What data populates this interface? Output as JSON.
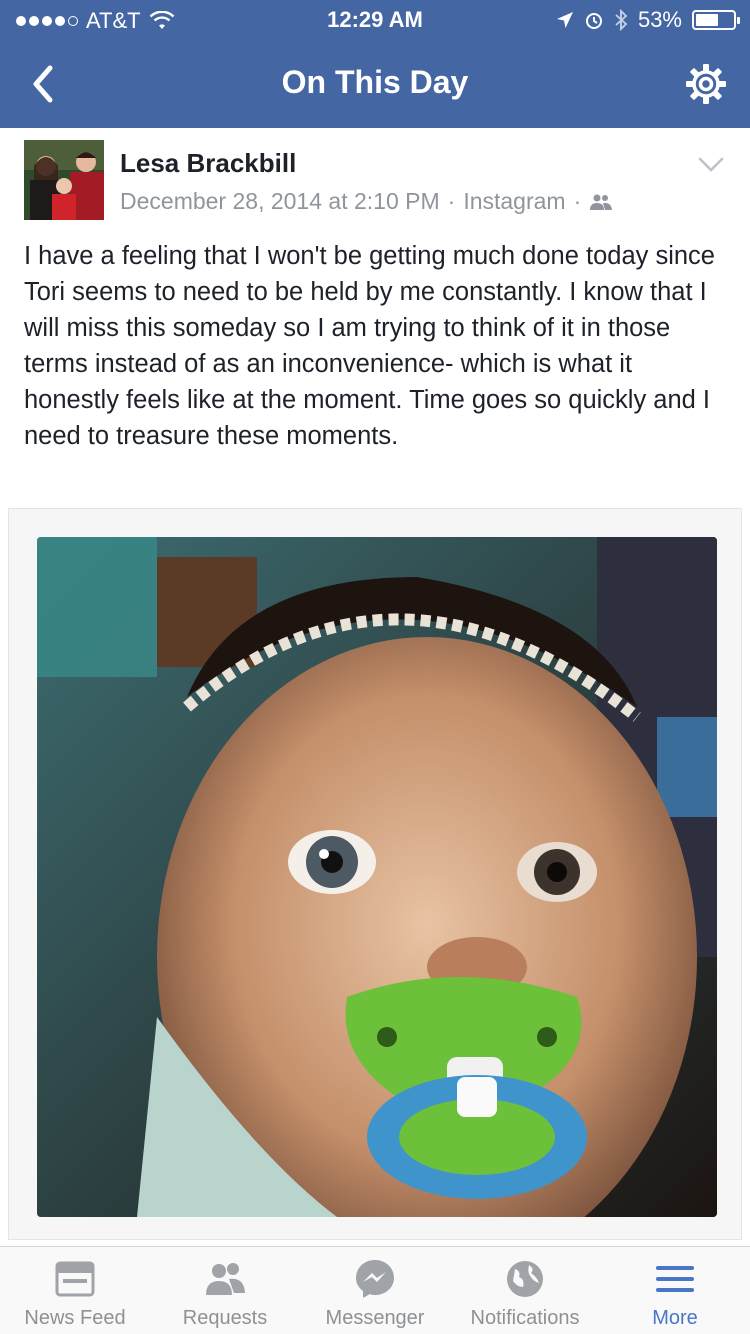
{
  "status_bar": {
    "carrier": "AT&T",
    "time": "12:29 AM",
    "battery": "53%",
    "battery_level": 0.53
  },
  "nav": {
    "title": "On This Day",
    "back_icon": "chevron-left-icon",
    "settings_icon": "gear-icon"
  },
  "post": {
    "author": "Lesa Brackbill",
    "date": "December 28, 2014 at 2:10 PM",
    "separator": "·",
    "source": "Instagram",
    "audience_icon": "friends-icon",
    "text": "I have a feeling that I won't be getting much done today since Tori seems to need to be held by me constantly. I know that I will miss this someday so I am trying to think of it in those terms instead of as an inconvenience- which is what it honestly feels like at the moment. Time goes so quickly and I need to treasure these moments."
  },
  "tabs": [
    {
      "label": "News Feed",
      "icon": "news-feed-icon"
    },
    {
      "label": "Requests",
      "icon": "requests-icon"
    },
    {
      "label": "Messenger",
      "icon": "messenger-icon"
    },
    {
      "label": "Notifications",
      "icon": "globe-icon"
    },
    {
      "label": "More",
      "icon": "menu-icon",
      "active": true
    }
  ],
  "colors": {
    "header": "#4467a3",
    "active_tab": "#4a76c8",
    "inactive_tab": "#8e9194"
  }
}
